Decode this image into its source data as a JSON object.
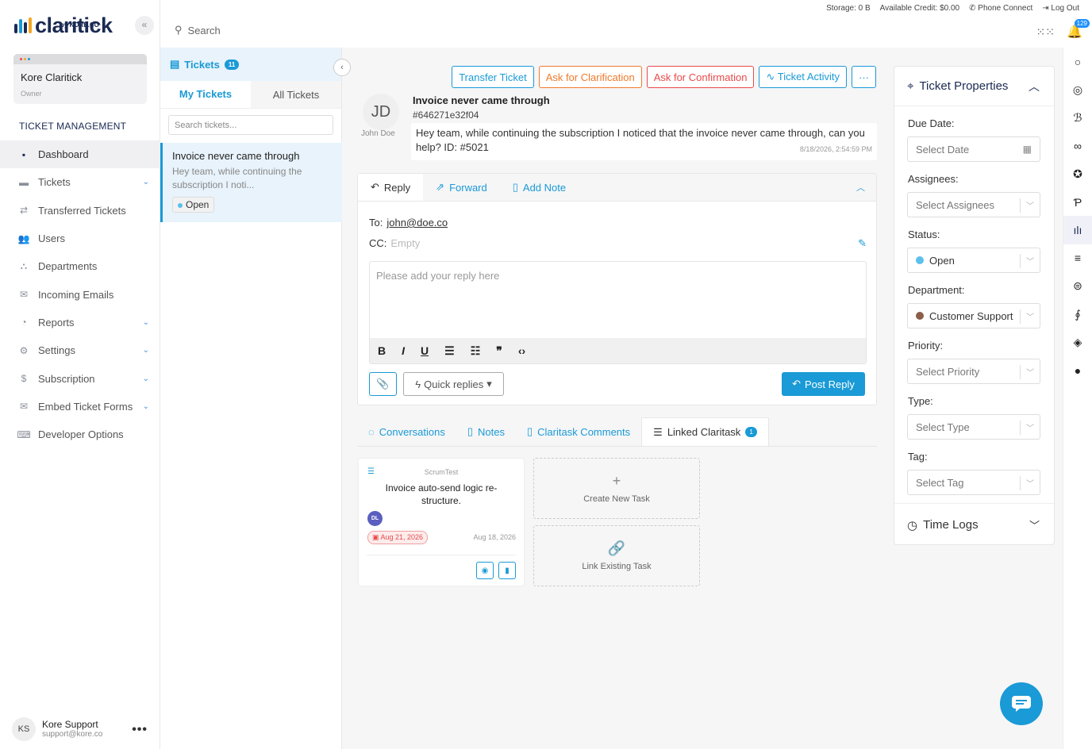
{
  "brand": {
    "name": "claritick",
    "sub": "by KORE.CO",
    "accent": "#1a9ad6",
    "navy": "#1a2a52"
  },
  "sidebar": {
    "collapse_glyph": "«",
    "org": {
      "name": "Kore Claritick",
      "role": "Owner"
    },
    "section_title": "TICKET MANAGEMENT",
    "items": [
      {
        "label": "Dashboard",
        "icon": "dashboard-icon",
        "glyph": "▪",
        "active": true,
        "chevron": false
      },
      {
        "label": "Tickets",
        "icon": "ticket-icon",
        "glyph": "▬",
        "chevron": true
      },
      {
        "label": "Transferred Tickets",
        "icon": "transfer-icon",
        "glyph": "⇄",
        "chevron": false
      },
      {
        "label": "Users",
        "icon": "users-icon",
        "glyph": "👥",
        "chevron": false
      },
      {
        "label": "Departments",
        "icon": "departments-icon",
        "glyph": "⛬",
        "chevron": false
      },
      {
        "label": "Incoming Emails",
        "icon": "mail-icon",
        "glyph": "✉",
        "chevron": false
      },
      {
        "label": "Reports",
        "icon": "reports-icon",
        "glyph": "◔",
        "chevron": true
      },
      {
        "label": "Settings",
        "icon": "gear-icon",
        "glyph": "⚙",
        "chevron": true
      },
      {
        "label": "Subscription",
        "icon": "dollar-icon",
        "glyph": "$",
        "chevron": true
      },
      {
        "label": "Embed Ticket Forms",
        "icon": "embed-icon",
        "glyph": "✉",
        "chevron": true
      },
      {
        "label": "Developer Options",
        "icon": "code-icon",
        "glyph": "⌨",
        "chevron": false
      }
    ],
    "chevron_glyph": "⌄",
    "user": {
      "initials": "KS",
      "name": "Kore Support",
      "email": "support@kore.co",
      "more": "•••"
    }
  },
  "topbar": {
    "storage": "Storage: 0 B",
    "credit": "Available Credit: $0.00",
    "phone": "Phone Connect",
    "logout": "Log Out",
    "search_placeholder": "Search",
    "notif_count": "129"
  },
  "list_panel": {
    "title": "Tickets",
    "count": "11",
    "tabs": [
      "My Tickets",
      "All Tickets"
    ],
    "search_placeholder": "Search tickets...",
    "ticket": {
      "title": "Invoice never came through",
      "snippet": "Hey team, while continuing the subscription I noti...",
      "status": "Open"
    }
  },
  "ticket": {
    "actions": [
      "Transfer Ticket",
      "Ask for Clarification",
      "Ask for Confirmation",
      "Ticket Activity",
      "···"
    ],
    "requester": {
      "initials": "JD",
      "name": "John Doe"
    },
    "title": "Invoice never came through",
    "id": "#646271e32f04",
    "message": "Hey team, while continuing the subscription I noticed that the invoice never came through, can you help? ID: #5021",
    "time": "8/18/2026, 2:54:59 PM"
  },
  "reply": {
    "tabs": [
      "Reply",
      "Forward",
      "Add Note"
    ],
    "to_label": "To:",
    "to_value": "john@doe.co",
    "cc_label": "CC:",
    "cc_value": "Empty",
    "placeholder": "Please add your reply here",
    "toolbar": [
      "B",
      "I",
      "U",
      "☰",
      "☷",
      "❞",
      "‹›"
    ],
    "quick": "Quick replies",
    "post": "Post Reply"
  },
  "conv_tabs": [
    {
      "label": "Conversations",
      "icon": "chat-icon"
    },
    {
      "label": "Notes",
      "icon": "note-icon"
    },
    {
      "label": "Claritask Comments",
      "icon": "comment-icon"
    },
    {
      "label": "Linked Claritask",
      "icon": "list-icon",
      "badge": "1",
      "active": true
    }
  ],
  "task": {
    "project": "ScrumTest",
    "title": "Invoice auto-send logic re-structure.",
    "assignee": "DL",
    "due": "Aug 21, 2026",
    "created": "Aug 18, 2026"
  },
  "create_task": {
    "label": "Create New Task",
    "glyph": "+"
  },
  "link_task": {
    "label": "Link Existing Task",
    "glyph": "🔗"
  },
  "props": {
    "title": "Ticket Properties",
    "fields": [
      {
        "label": "Due Date:",
        "value": "Select Date",
        "kind": "date"
      },
      {
        "label": "Assignees:",
        "value": "Select Assignees",
        "kind": "select"
      },
      {
        "label": "Status:",
        "value": "Open",
        "kind": "select",
        "dot": "#5bc0eb"
      },
      {
        "label": "Department:",
        "value": "Customer Support",
        "kind": "select",
        "dot": "#8b5e4a"
      },
      {
        "label": "Priority:",
        "value": "Select Priority",
        "kind": "select"
      },
      {
        "label": "Type:",
        "value": "Select Type",
        "kind": "select"
      },
      {
        "label": "Tag:",
        "value": "Select Tag",
        "kind": "select"
      }
    ],
    "time_logs": "Time Logs"
  },
  "rail": [
    "circle-icon",
    "target-icon",
    "swirl-icon",
    "infinity-icon",
    "star-icon",
    "p-icon",
    "claritick-icon",
    "lines-icon",
    "stack-icon",
    "book-icon",
    "layers-icon",
    "globe-icon"
  ]
}
